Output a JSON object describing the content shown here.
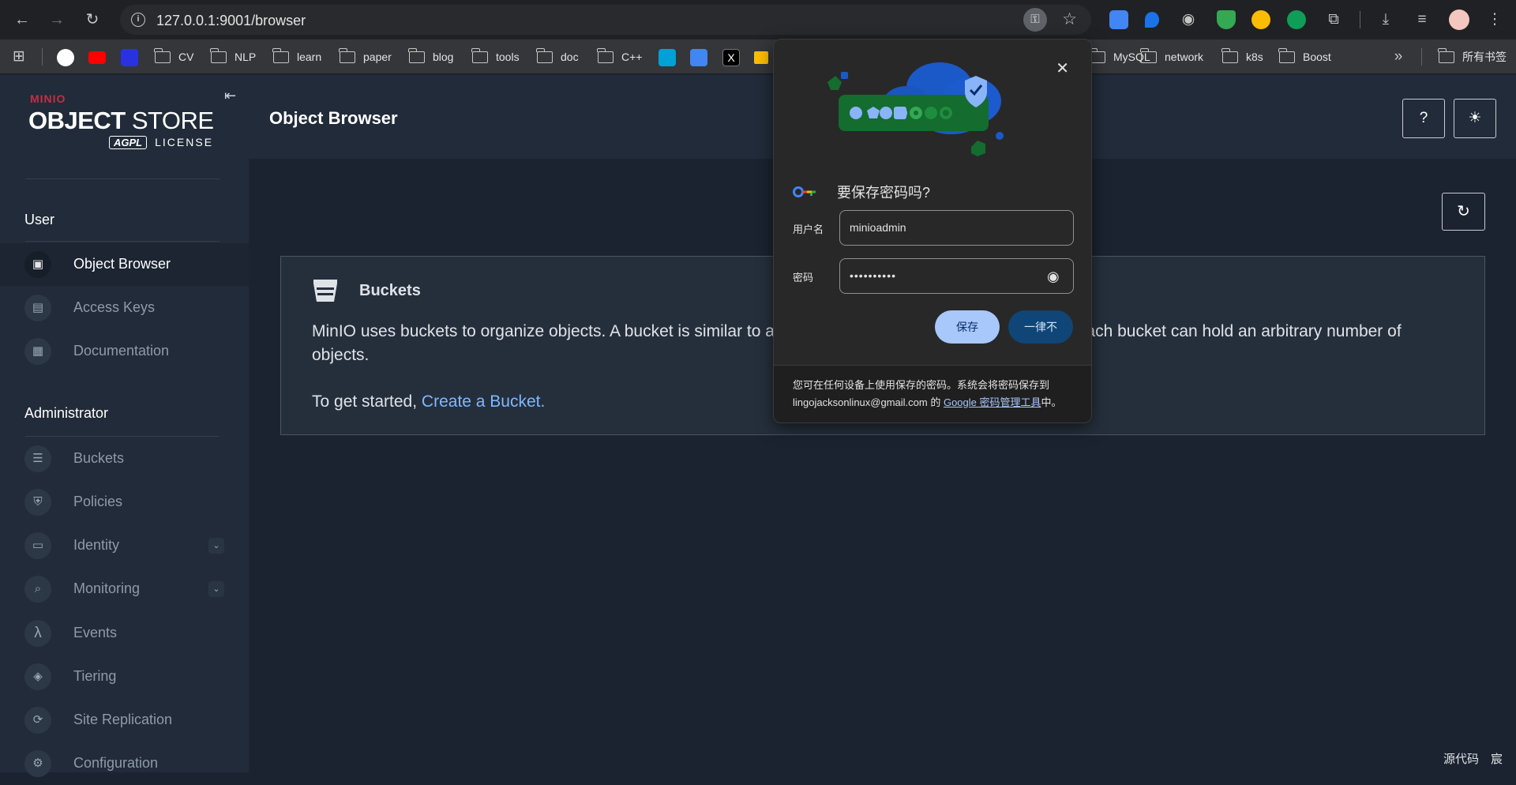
{
  "browser": {
    "url": "127.0.0.1:9001/browser",
    "key_icon": "key-icon",
    "bookmarks": [
      "CV",
      "NLP",
      "learn",
      "paper",
      "blog",
      "tools",
      "doc",
      "C++",
      "MySQL",
      "network",
      "k8s",
      "Boost"
    ],
    "all_bookmarks": "所有书签"
  },
  "brand": {
    "small": "MINIO",
    "object": "OBJECT",
    "store": "STORE",
    "agpl": "AGPL",
    "license": "LICENSE",
    "color": "#c72c48"
  },
  "sidebar": {
    "section_user": "User",
    "section_admin": "Administrator",
    "user_items": [
      {
        "label": "Object Browser",
        "icon": "browser-icon",
        "active": true
      },
      {
        "label": "Access Keys",
        "icon": "key-icon"
      },
      {
        "label": "Documentation",
        "icon": "document-icon"
      }
    ],
    "admin_items": [
      {
        "label": "Buckets",
        "icon": "bucket-icon"
      },
      {
        "label": "Policies",
        "icon": "shield-icon"
      },
      {
        "label": "Identity",
        "icon": "id-card-icon",
        "expandable": true
      },
      {
        "label": "Monitoring",
        "icon": "magnifier-icon",
        "expandable": true
      },
      {
        "label": "Events",
        "icon": "lambda-icon"
      },
      {
        "label": "Tiering",
        "icon": "layers-icon"
      },
      {
        "label": "Site Replication",
        "icon": "sync-icon"
      },
      {
        "label": "Configuration",
        "icon": "gear-icon"
      }
    ]
  },
  "main": {
    "title": "Object Browser",
    "card": {
      "title": "Buckets",
      "text": "MinIO uses buckets to organize objects. A bucket is similar to a folder or directory in a filesystem, where each bucket can hold an arbitrary number of objects.",
      "start_prefix": "To get started,",
      "start_link": "Create a Bucket."
    }
  },
  "popup": {
    "title": "要保存密码吗?",
    "username_label": "用户名",
    "username_value": "minioadmin",
    "password_label": "密码",
    "password_value": "••••••••••",
    "save": "保存",
    "never": "一律不",
    "footer_text": "您可在任何设备上使用保存的密码。系统会将密码保存到 lingojacksonlinux@gmail.com 的 ",
    "footer_link": "Google 密码管理工具",
    "footer_end": "中。",
    "save_color": "#a8c7fa",
    "never_color": "#0f4677"
  },
  "corner": "源代码　宸"
}
